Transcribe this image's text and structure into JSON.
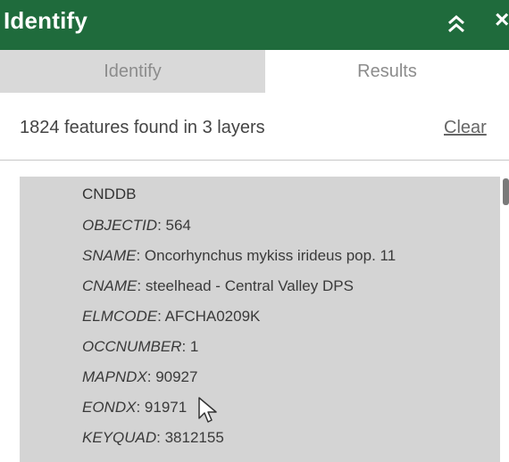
{
  "panel": {
    "title": "Identify",
    "collapse_icon": "double-chevron-up-icon",
    "close_icon": "close-icon",
    "close_glyph": "×",
    "accent_color": "#1f6b3c"
  },
  "tabs": [
    {
      "label": "Identify",
      "active": false
    },
    {
      "label": "Results",
      "active": true
    }
  ],
  "summary": {
    "text": "1824 features found in 3 layers",
    "clear_label": "Clear"
  },
  "result": {
    "layer": "CNDDB",
    "attributes": [
      {
        "key": "OBJECTID",
        "sep": ": ",
        "value": "564"
      },
      {
        "key": "SNAME",
        "sep": ": ",
        "value": "Oncorhynchus mykiss irideus pop. 11"
      },
      {
        "key": "CNAME",
        "sep": ": ",
        "value": "steelhead - Central Valley DPS"
      },
      {
        "key": "ELMCODE",
        "sep": ": ",
        "value": "AFCHA0209K"
      },
      {
        "key": "OCCNUMBER",
        "sep": ": ",
        "value": "1"
      },
      {
        "key": "MAPNDX",
        "sep": ": ",
        "value": "90927"
      },
      {
        "key": "EONDX",
        "sep": ": ",
        "value": "91971"
      },
      {
        "key": "KEYQUAD",
        "sep": ": ",
        "value": "3812155"
      }
    ]
  }
}
